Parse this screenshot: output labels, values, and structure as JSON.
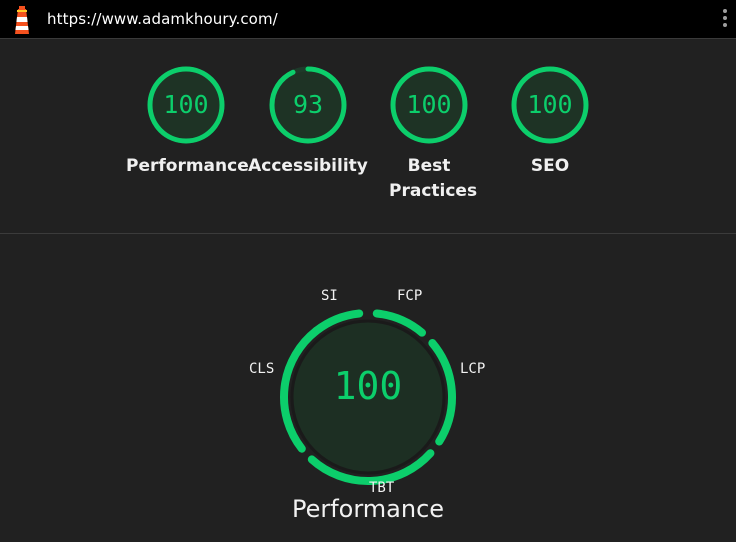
{
  "browser": {
    "url": "https://www.adamkhoury.com/",
    "logo_icon": "lighthouse-icon",
    "menu_icon": "kebab-menu-icon"
  },
  "colors": {
    "pass": "#0cce6b",
    "track": "#1e3a2a",
    "background": "#212121"
  },
  "summary": {
    "gauges": [
      {
        "score": "100",
        "value": 100,
        "label": "Performance"
      },
      {
        "score": "93",
        "value": 93,
        "label": "Accessibility"
      },
      {
        "score": "100",
        "value": 100,
        "label": "Best Practices"
      },
      {
        "score": "100",
        "value": 100,
        "label": "SEO"
      }
    ]
  },
  "performance": {
    "score": "100",
    "title": "Performance",
    "metrics": [
      "SI",
      "FCP",
      "LCP",
      "TBT",
      "CLS"
    ]
  }
}
